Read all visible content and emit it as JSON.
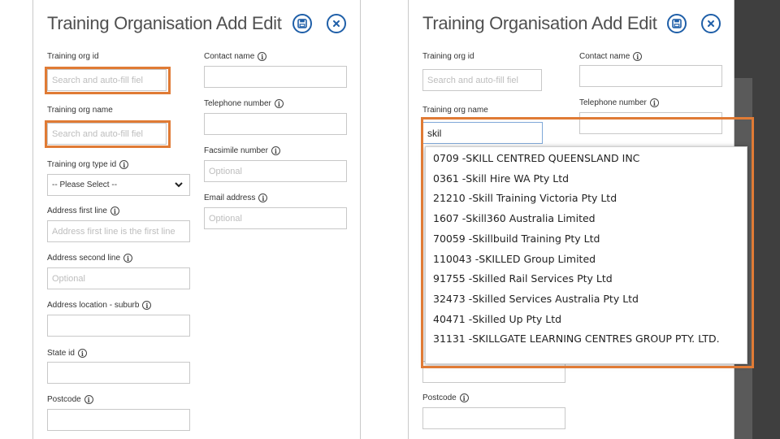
{
  "form": {
    "title": "Training Organisation Add Edit",
    "fields": {
      "org_id_label": "Training org id",
      "org_id_placeholder": "Search and auto-fill fiel",
      "org_name_label": "Training org name",
      "org_name_placeholder": "Search and auto-fill fiel",
      "org_name_value": "skil",
      "type_label": "Training org type id",
      "type_value": "-- Please Select --",
      "addr1_label": "Address first line",
      "addr1_placeholder": "Address first line is the first line",
      "addr2_label": "Address second line",
      "addr2_placeholder": "Optional",
      "suburb_label": "Address location - suburb",
      "state_label": "State id",
      "postcode_label": "Postcode",
      "contact_label": "Contact name",
      "phone_label": "Telephone number",
      "fax_label": "Facsimile number",
      "fax_placeholder": "Optional",
      "email_label": "Email address",
      "email_placeholder": "Optional"
    }
  },
  "autocomplete": {
    "items": [
      "0709 -SKILL CENTRED QUEENSLAND INC",
      "0361 -Skill Hire WA Pty Ltd",
      "21210 -Skill Training Victoria Pty Ltd",
      "1607 -Skill360 Australia Limited",
      "70059 -Skillbuild Training Pty Ltd",
      "110043 -SKILLED Group Limited",
      "91755 -Skilled Rail Services Pty Ltd",
      "32473 -Skilled Services Australia Pty Ltd",
      "40471 -Skilled Up Pty Ltd",
      "31131 -SKILLGATE LEARNING CENTRES GROUP PTY. LTD."
    ]
  },
  "colors": {
    "highlight": "#e07b35",
    "accent": "#1f5fa8",
    "gutter": "#3f3f3f"
  }
}
